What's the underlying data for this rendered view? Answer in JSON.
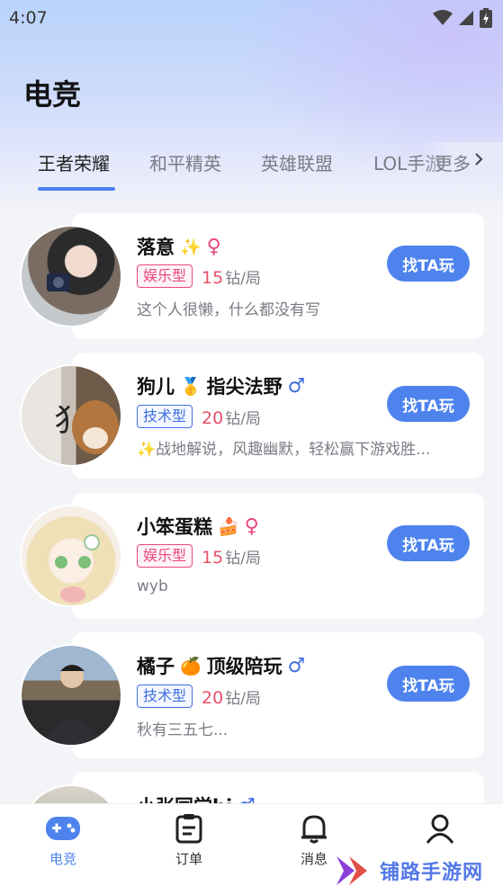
{
  "status_bar": {
    "time": "4:07"
  },
  "page_title": "电竞",
  "tabs": [
    {
      "label": "王者荣耀",
      "active": true
    },
    {
      "label": "和平精英",
      "active": false
    },
    {
      "label": "英雄联盟",
      "active": false
    },
    {
      "label": "LOL手游",
      "active": false
    }
  ],
  "more_label": "更多",
  "colors": {
    "accent": "#4e83ee",
    "entertainment_tag": "#e8497a",
    "tech_tag": "#3f6fe0",
    "price": "#e8506a"
  },
  "players": [
    {
      "name": "落意",
      "name_emoji": "✨",
      "gender": "♀",
      "tag": "娱乐型",
      "tag_type": "entertainment",
      "price": "15",
      "unit": "钻/局",
      "bio": "这个人很懒，什么都没有写",
      "action": "找TA玩"
    },
    {
      "name": "狗儿",
      "name_emoji": "🥇",
      "name_suffix": "指尖法野",
      "gender": "♂",
      "tag": "技术型",
      "tag_type": "tech",
      "price": "20",
      "unit": "钻/局",
      "bio": "✨战地解说，风趣幽默，轻松赢下游戏胜...",
      "action": "找TA玩"
    },
    {
      "name": "小笨蛋糕",
      "name_emoji": "🍰",
      "gender": "♀",
      "tag": "娱乐型",
      "tag_type": "entertainment",
      "price": "15",
      "unit": "钻/局",
      "bio": "wyb",
      "action": "找TA玩"
    },
    {
      "name": "橘子",
      "name_emoji": "🍊",
      "name_suffix": "顶级陪玩",
      "gender": "♂",
      "tag": "技术型",
      "tag_type": "tech",
      "price": "20",
      "unit": "钻/局",
      "bio": "秋有三五七...",
      "action": "找TA玩"
    },
    {
      "name": "小张同学hi",
      "gender": "♂"
    }
  ],
  "bottom_nav": [
    {
      "label": "电竞",
      "icon": "gamepad-icon",
      "active": true
    },
    {
      "label": "订单",
      "icon": "clipboard-icon",
      "active": false
    },
    {
      "label": "消息",
      "icon": "bell-icon",
      "active": false
    },
    {
      "label": "",
      "icon": "person-icon",
      "active": false
    }
  ],
  "watermark": "铺路手游网"
}
